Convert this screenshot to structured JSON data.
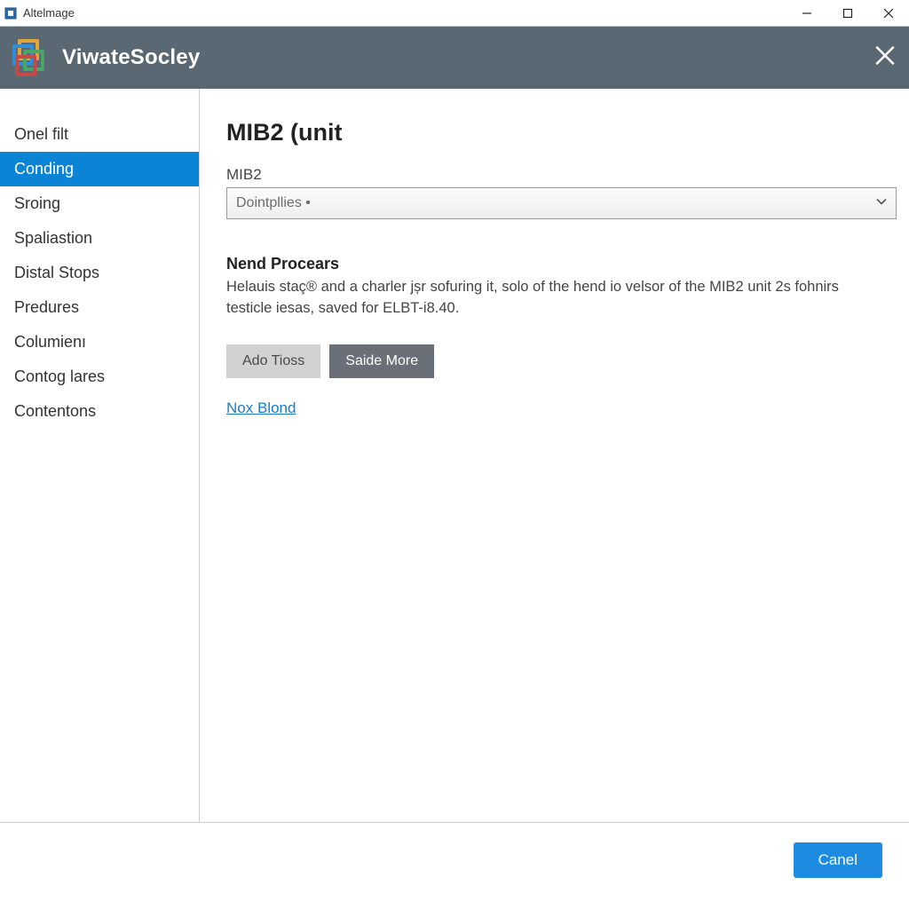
{
  "window": {
    "title": "Altelmage"
  },
  "brand": {
    "name": "ViwateSocley"
  },
  "sidebar": {
    "items": [
      {
        "label": "Onel filt",
        "active": false
      },
      {
        "label": "Conding",
        "active": true
      },
      {
        "label": "Sroing",
        "active": false
      },
      {
        "label": "Spaliastion",
        "active": false
      },
      {
        "label": "Distal Stops",
        "active": false
      },
      {
        "label": "Predures",
        "active": false
      },
      {
        "label": "Columienı",
        "active": false
      },
      {
        "label": "Contog lares",
        "active": false
      },
      {
        "label": "Contentons",
        "active": false
      }
    ]
  },
  "main": {
    "title": "MIB2 (unit",
    "select": {
      "label": "MIB2",
      "value": "Dointpllies •"
    },
    "section": {
      "heading": "Nend Procears",
      "body": "Helauis staç® and a charler jșr sofuring it, solo of the hend io velsor of the MIB2 unit 2s fohnirs testicle iesas, saved for ELBT-i8.40."
    },
    "buttons": {
      "light": "Ado Tioss",
      "dark": "Saide More"
    },
    "link": "Nox Blond"
  },
  "footer": {
    "primary": "Canel"
  }
}
